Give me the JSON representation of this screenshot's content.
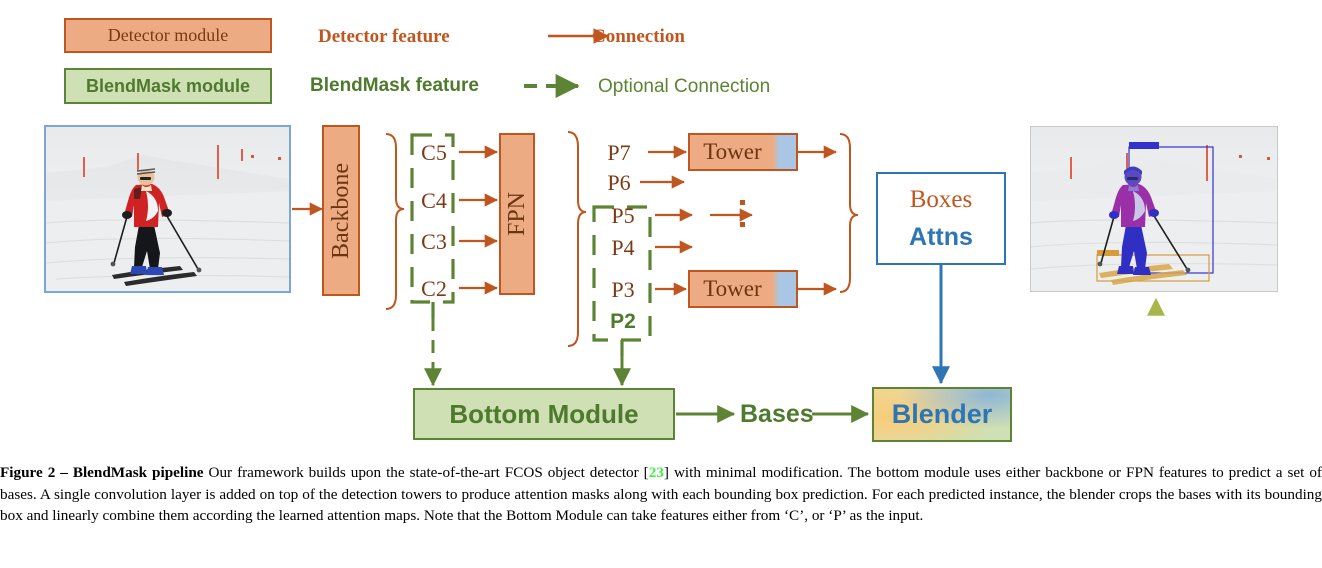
{
  "legend": {
    "detector_module": "Detector module",
    "blendmask_module": "BlendMask module",
    "detector_feature": "Detector feature",
    "blendmask_feature": "BlendMask feature",
    "connection": "Connection",
    "optional_connection": "Optional Connection",
    "colors": {
      "detector_fill": "#edab83",
      "detector_stroke": "#c0561f",
      "blendmask_fill": "#cfe0b4",
      "blendmask_stroke": "#5d8434",
      "attention_blue": "#2e75b6"
    }
  },
  "diagram": {
    "backbone": "Backbone",
    "fpn": "FPN",
    "tower_top": "Tower",
    "tower_bottom": "Tower",
    "ellipsis": "⋮",
    "boxes": "Boxes",
    "attns": "Attns",
    "bottom_module": "Bottom Module",
    "bases": "Bases",
    "blender": "Blender",
    "c_levels": [
      "C5",
      "C4",
      "C3",
      "C2"
    ],
    "p_levels": [
      "P7",
      "P6",
      "P5",
      "P4",
      "P3",
      "P2"
    ],
    "input_image_alt": "skier in red jacket on snow slope",
    "output_image_alt": "same skier with blue person mask and orange ski mask plus bounding boxes"
  },
  "caption": {
    "label": "Figure 2 – ",
    "title": "BlendMask pipeline",
    "text_before_cite": " Our framework builds upon the state-of-the-art FCOS object detector [",
    "cite": "23",
    "text_after_cite": "] with minimal modification. The bottom module uses either backbone or FPN features to predict a set of bases. A single convolution layer is added on top of the detection towers to produce attention masks along with each bounding box prediction. For each predicted instance, the blender crops the bases with its bounding box and linearly combine them according the learned attention maps. Note that the Bottom Module can take features either from ‘C’, or ‘P’ as the input."
  }
}
